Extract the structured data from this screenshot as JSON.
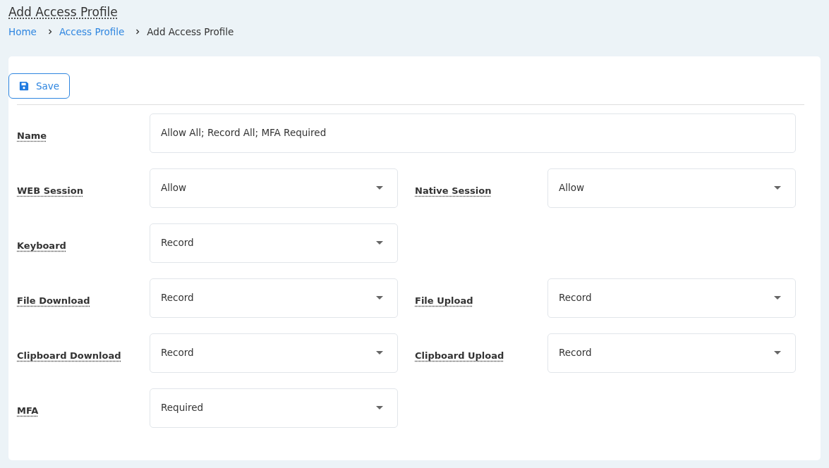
{
  "page_title": "Add Access Profile",
  "breadcrumb": [
    {
      "label": "Home",
      "kind": "link"
    },
    {
      "label": "Access Profile",
      "kind": "link"
    },
    {
      "label": "Add Access Profile",
      "kind": "current"
    }
  ],
  "toolbar": {
    "save_button": "Save"
  },
  "rows": [
    {
      "fields": [
        {
          "kind": "text",
          "label": "Name",
          "value": "Allow All; Record All; MFA Required"
        }
      ]
    },
    {
      "fields": [
        {
          "kind": "select",
          "label": "WEB Session",
          "value": "Allow"
        },
        {
          "kind": "select",
          "label": "Native Session",
          "value": "Allow"
        }
      ]
    },
    {
      "fields": [
        {
          "kind": "select",
          "label": "Keyboard",
          "value": "Record"
        }
      ]
    },
    {
      "fields": [
        {
          "kind": "select",
          "label": "File Download",
          "value": "Record"
        },
        {
          "kind": "select",
          "label": "File Upload",
          "value": "Record"
        }
      ]
    },
    {
      "fields": [
        {
          "kind": "select",
          "label": "Clipboard Download",
          "value": "Record"
        },
        {
          "kind": "select",
          "label": "Clipboard Upload",
          "value": "Record"
        }
      ]
    },
    {
      "fields": [
        {
          "kind": "select",
          "label": "MFA",
          "value": "Required"
        }
      ]
    }
  ]
}
